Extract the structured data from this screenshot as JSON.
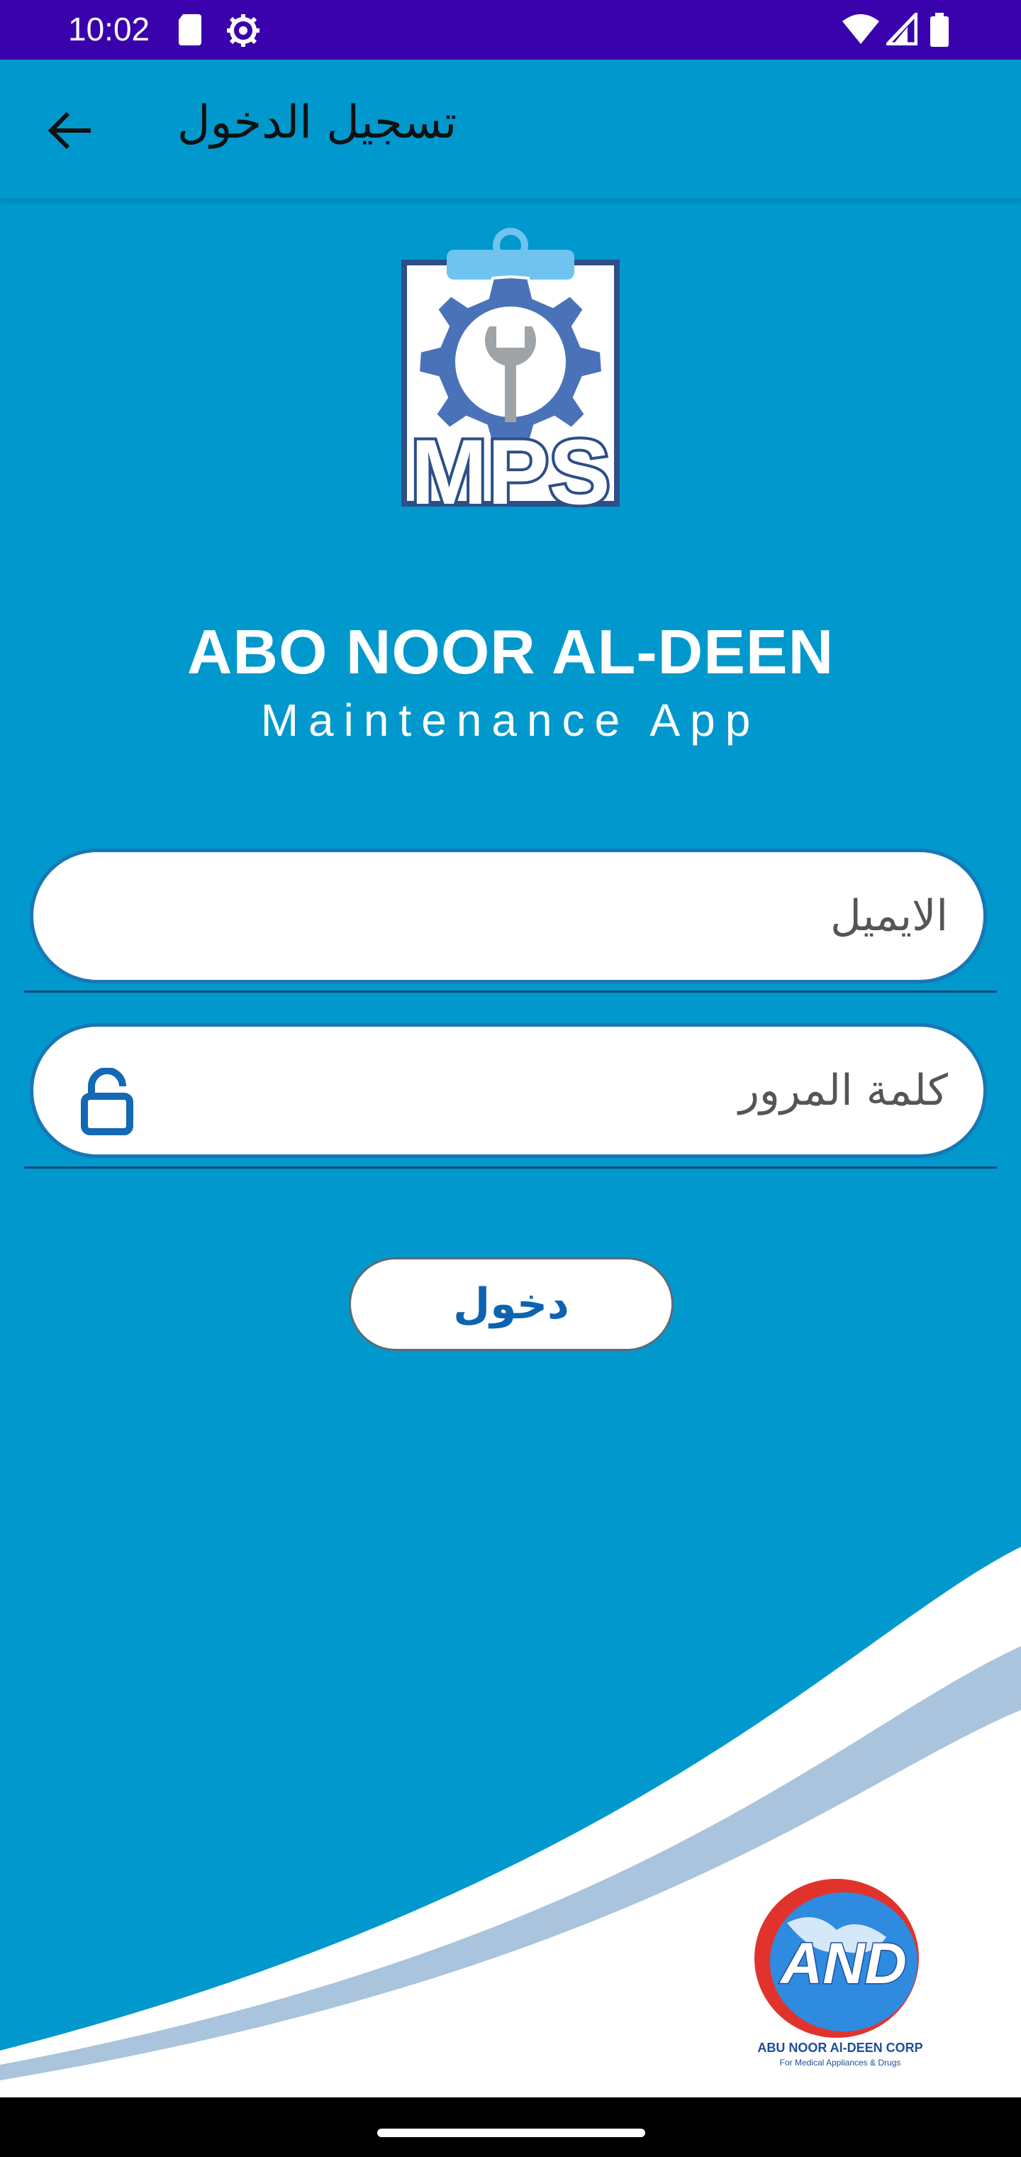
{
  "status_bar": {
    "time": "10:02"
  },
  "app_bar": {
    "title": "تسجيل الدخول"
  },
  "brand": {
    "title": "ABO NOOR AL-DEEN",
    "subtitle": "Maintenance App",
    "logo_text": "MPS"
  },
  "form": {
    "email_placeholder": "الايميل",
    "email_value": "",
    "password_placeholder": "كلمة المرور",
    "password_value": "",
    "submit_label": "دخول"
  },
  "corp": {
    "logo_text": "AND",
    "name": "ABU NOOR Al-DEEN CORP",
    "tagline": "For Medical Appliances & Drugs"
  },
  "colors": {
    "background": "#0098cd",
    "status_bar": "#3a02ad",
    "field_border": "#1777b5",
    "button_text": "#0e63b0"
  },
  "icons": [
    "sd-card-icon",
    "settings-icon",
    "wifi-icon",
    "signal-icon",
    "battery-icon",
    "back-arrow-icon",
    "lock-icon"
  ]
}
